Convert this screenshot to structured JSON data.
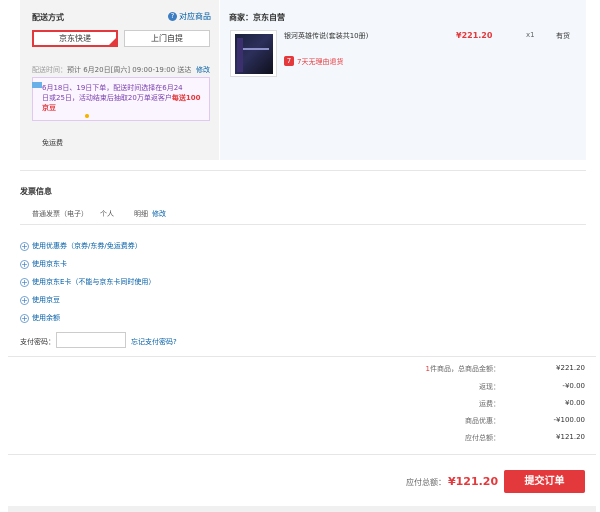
{
  "delivery": {
    "title": "配送方式",
    "store_link": "对应商品",
    "options": [
      {
        "label": "京东快递",
        "selected": true
      },
      {
        "label": "上门自提",
        "selected": false
      }
    ],
    "time_label": "配送时间：",
    "time_value": "预计 6月20日[周六] 09:00-19:00 送达",
    "modify": "修改",
    "notice_line1": "6月18日、19日下单，配送时间选择在6月24",
    "notice_line2": "日或25日，活动结束后抽取20万单返客户",
    "notice_red1": "每送100",
    "notice_red2": "京豆",
    "free_shipping": "免运费"
  },
  "goods": {
    "seller": "商家：京东自营",
    "item_name": "银河英雄传说(套装共10册)",
    "price": "¥221.20",
    "qty": "x1",
    "stock": "有货",
    "return_badge": "7",
    "return_text": "7天无理由退货"
  },
  "invoice": {
    "title": "发票信息",
    "type": "普通发票（电子）",
    "holder": "个人",
    "detail": "明细",
    "modify": "修改"
  },
  "options": [
    "使用优惠券（京券/东券/免运费券）",
    "使用京东卡",
    "使用京东E卡（不能与京东卡同时使用）",
    "使用京豆",
    "使用余额"
  ],
  "payment": {
    "password_label": "支付密码：",
    "forgot": "忘记支付密码?"
  },
  "summary": {
    "count": "1",
    "count_suffix": "件商品，总商品金额：",
    "total_goods": "¥221.20",
    "cashback_label": "返现：",
    "cashback": "-¥0.00",
    "shipping_label": "运费：",
    "shipping": "¥0.00",
    "discount_label": "商品优惠：",
    "discount": "-¥100.00",
    "due_label": "应付总额：",
    "due": "¥121.20"
  },
  "footer": {
    "pay_label": "应付总额：",
    "pay_total": "¥121.20",
    "submit": "提交订单"
  }
}
